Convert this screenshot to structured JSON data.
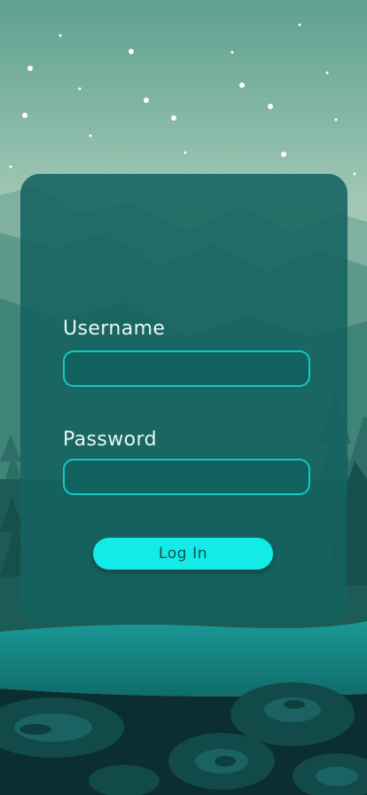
{
  "login": {
    "username_label": "Username",
    "username_value": "",
    "password_label": "Password",
    "password_value": "",
    "login_button": "Log In"
  },
  "colors": {
    "sky_top": "#5fa090",
    "sky_bottom": "#c4dccd",
    "card": "#14625e",
    "field_border": "#14c9c4",
    "button": "#12ebe7",
    "water": "#148a87",
    "ground_dark": "#0b2e30"
  }
}
